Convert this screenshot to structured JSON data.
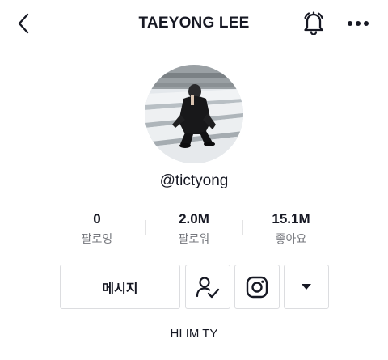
{
  "header": {
    "title": "TAEYONG LEE",
    "back_icon": "chevron-left-icon",
    "bell_icon": "bell-icon",
    "more_icon": "more-horizontal-icon"
  },
  "profile": {
    "avatar_icon": "profile-photo",
    "handle": "@tictyong",
    "bio": "HI IM TY"
  },
  "stats": [
    {
      "value": "0",
      "label": "팔로잉"
    },
    {
      "value": "2.0M",
      "label": "팔로워"
    },
    {
      "value": "15.1M",
      "label": "좋아요"
    }
  ],
  "actions": {
    "message_label": "메시지",
    "friend_icon": "person-check-icon",
    "instagram_icon": "instagram-icon",
    "dropdown_icon": "caret-down-icon"
  },
  "colors": {
    "text": "#161823",
    "secondary_text": "#75777d",
    "border": "#dcdde0"
  }
}
